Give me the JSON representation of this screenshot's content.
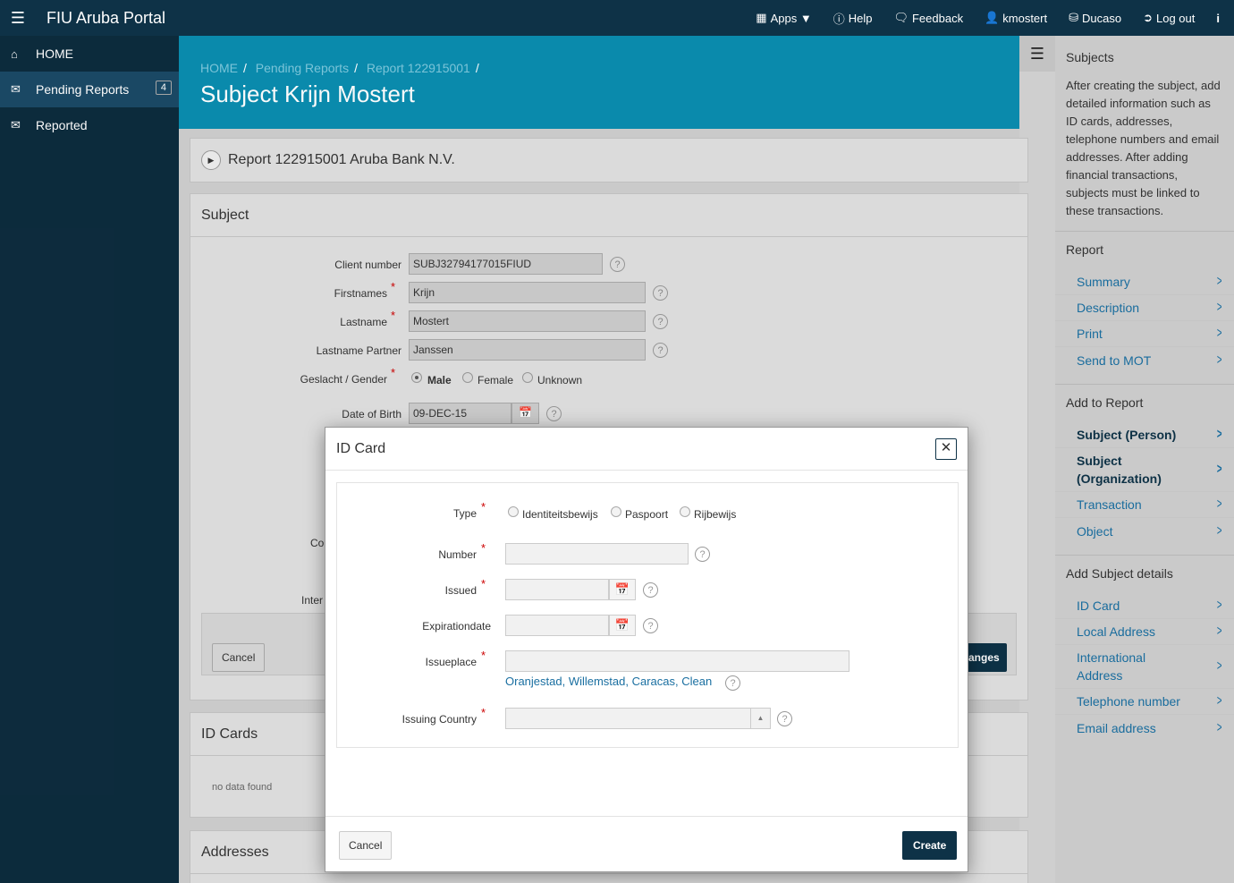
{
  "app": {
    "title": "FIU Aruba Portal"
  },
  "topnav": [
    {
      "icon": "apps-grid-icon",
      "label": "Apps ▼"
    },
    {
      "icon": "help-circle-icon",
      "label": "Help"
    },
    {
      "icon": "chat-bubble-icon",
      "label": "Feedback"
    },
    {
      "icon": "user-icon",
      "label": "kmostert"
    },
    {
      "icon": "database-icon",
      "label": "Ducaso"
    },
    {
      "icon": "logout-icon",
      "label": "Log out"
    },
    {
      "icon": "info-icon",
      "label": ""
    }
  ],
  "sidebar": {
    "items": [
      {
        "icon": "home-icon",
        "label": "HOME"
      },
      {
        "icon": "envelope-open-icon",
        "label": "Pending Reports",
        "badge": "4"
      },
      {
        "icon": "envelope-icon",
        "label": "Reported"
      }
    ]
  },
  "breadcrumb": [
    "HOME",
    "Pending Reports",
    "Report 122915001",
    ""
  ],
  "page_title": "Subject Krijn Mostert",
  "report_panel": {
    "title": "Report 122915001 Aruba Bank N.V."
  },
  "subject_panel": {
    "title": "Subject",
    "client_number_label": "Client number",
    "client_number": "SUBJ32794177015FIUD",
    "firstnames_label": "Firstnames",
    "firstnames": "Krijn",
    "lastname_label": "Lastname",
    "lastname": "Mostert",
    "partner_label": "Lastname Partner",
    "partner": "Janssen",
    "gender_label": "Geslacht / Gender",
    "gender_options": [
      "Male",
      "Female",
      "Unknown"
    ],
    "dob_label": "Date of Birth",
    "dob": "09-DEC-15",
    "partial_label_1": "Co",
    "partial_label_2": "Inter",
    "cancel": "Cancel",
    "save_partial": "anges"
  },
  "id_cards_panel": {
    "title": "ID Cards",
    "empty": "no data found"
  },
  "addresses_panel": {
    "title": "Addresses"
  },
  "rightpanel": {
    "subjects_title": "Subjects",
    "help_text": "After creating the subject, add detailed information such as ID cards, addresses, telephone numbers and email addresses. After adding financial transactions, subjects must be linked to these transactions.",
    "report_title": "Report",
    "report_links": [
      "Summary",
      "Description",
      "Print",
      "Send to MOT"
    ],
    "add_report_title": "Add to Report",
    "add_report_links": [
      "Subject (Person)",
      "Subject (Organization)",
      "Transaction",
      "Object"
    ],
    "subject_details_title": "Add Subject details",
    "subject_details_links": [
      "ID Card",
      "Local Address",
      "International Address",
      "Telephone number",
      "Email address"
    ]
  },
  "modal": {
    "title": "ID Card",
    "type_label": "Type",
    "type_options": [
      "Identiteitsbewijs",
      "Paspoort",
      "Rijbewijs"
    ],
    "number_label": "Number",
    "number_value": "",
    "issued_label": "Issued",
    "issued_value": "",
    "expiration_label": "Expirationdate",
    "expiration_value": "",
    "issueplace_label": "Issueplace",
    "issueplace_value": "",
    "issueplace_suggestions": "Oranjestad, Willemstad, Caracas, Clean",
    "country_label": "Issuing Country",
    "country_value": "",
    "cancel": "Cancel",
    "create": "Create"
  }
}
